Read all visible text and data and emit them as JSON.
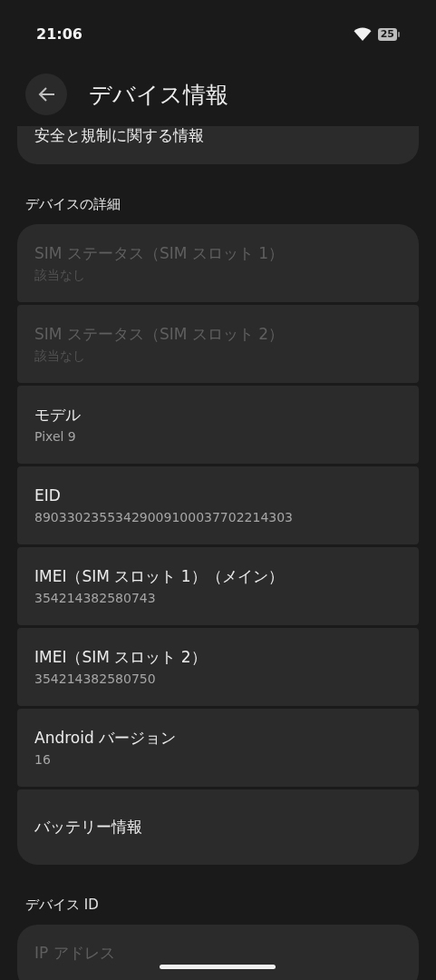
{
  "status_bar": {
    "time": "21:06",
    "battery": "25"
  },
  "header": {
    "title": "デバイス情報"
  },
  "clipped_item": {
    "title": "安全と規制に関する情報"
  },
  "sections": [
    {
      "title": "デバイスの詳細",
      "items": [
        {
          "title": "SIM ステータス（SIM スロット 1）",
          "summary": "該当なし",
          "disabled": true
        },
        {
          "title": "SIM ステータス（SIM スロット 2）",
          "summary": "該当なし",
          "disabled": true
        },
        {
          "title": "モデル",
          "summary": "Pixel 9",
          "disabled": false
        },
        {
          "title": "EID",
          "summary": "89033023553429009100037702214303",
          "disabled": false
        },
        {
          "title": "IMEI（SIM スロット 1）（メイン）",
          "summary": "354214382580743",
          "disabled": false
        },
        {
          "title": "IMEI（SIM スロット 2）",
          "summary": "354214382580750",
          "disabled": false
        },
        {
          "title": "Android バージョン",
          "summary": "16",
          "disabled": false
        },
        {
          "title": "バッテリー情報",
          "disabled": false
        }
      ]
    },
    {
      "title": "デバイス ID",
      "items": [
        {
          "title": "IP アドレス",
          "disabled": true
        }
      ]
    }
  ]
}
